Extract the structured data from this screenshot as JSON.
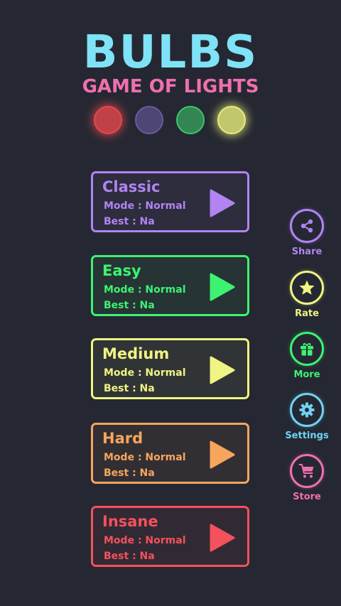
{
  "header": {
    "title": "BULBS",
    "subtitle": "GAME OF LIGHTS"
  },
  "bulbs": [
    {
      "color": "#e9474d",
      "on": true
    },
    {
      "color": "#6a5aa0",
      "on": false
    },
    {
      "color": "#3ec56a",
      "on": false
    },
    {
      "color": "#e8ef7c",
      "on": true
    }
  ],
  "modes": [
    {
      "name": "Classic",
      "mode": "Mode : Normal",
      "best": "Best : Na",
      "color": "#b184f2"
    },
    {
      "name": "Easy",
      "mode": "Mode : Normal",
      "best": "Best : Na",
      "color": "#3ef271"
    },
    {
      "name": "Medium",
      "mode": "Mode : Normal",
      "best": "Best : Na",
      "color": "#f0f483"
    },
    {
      "name": "Hard",
      "mode": "Mode : Normal",
      "best": "Best : Na",
      "color": "#f7a55c"
    },
    {
      "name": "Insane",
      "mode": "Mode : Normal",
      "best": "Best : Na",
      "color": "#f5515c"
    }
  ],
  "side_menu": [
    {
      "label": "Share",
      "icon": "share-icon",
      "color": "#b184f2"
    },
    {
      "label": "Rate",
      "icon": "star-icon",
      "color": "#f0f483"
    },
    {
      "label": "More",
      "icon": "gift-icon",
      "color": "#3ef271"
    },
    {
      "label": "Settings",
      "icon": "gear-icon",
      "color": "#6fd3f4"
    },
    {
      "label": "Store",
      "icon": "cart-icon",
      "color": "#f06fb0"
    }
  ]
}
